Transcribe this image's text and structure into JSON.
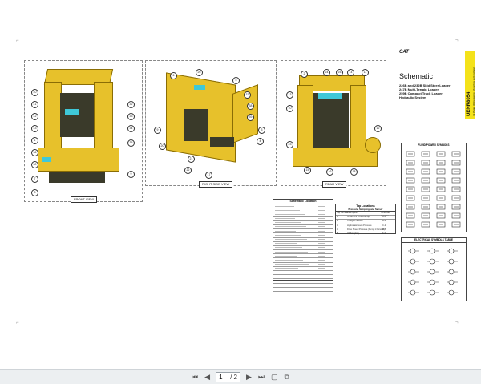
{
  "views": {
    "front_label": "FRONT VIEW",
    "right_side_label": "RIGHT SIDE VIEW",
    "rear_label": "REAR VIEW"
  },
  "title_block": {
    "brand": "CAT",
    "title": "Schematic",
    "subtitle_lines": [
      "226B and 232B Skid Steer Loader",
      "247B Multi-Terrain Loader",
      "259B Compact Track Loader",
      "Hydraulic System"
    ],
    "doc_code": "UENR8054",
    "doc_note": "42 Page, (Dimensions: 36 inches x 24 inches)"
  },
  "tables": {
    "harness_title": "Schematic Location",
    "tap_title": "Tap Locations",
    "tap_subtitle": "Pressure, Sampling, and Sensor",
    "tap_headers": [
      "Tap Number",
      "Description",
      "Schematic Location"
    ],
    "tap_rows": [
      [
        "1",
        "Implement Pressure Tap",
        "A-4"
      ],
      [
        "2",
        "Charge Pressure",
        "B-3"
      ],
      [
        "3",
        "Hydrostatic Loop Pressure",
        "C-2"
      ],
      [
        "4",
        "Drive Speed Pressure (Pump 1 Forward)",
        "D-5"
      ],
      [
        "5",
        "Oil Sampling",
        "E-6"
      ]
    ]
  },
  "symbols": {
    "fluid_title": "FLUID POWER SYMBOLS",
    "electrical_title": "ELECTRICAL SYMBOLS TABLE"
  },
  "toolbar": {
    "page_value": "1",
    "page_total": "/ 2"
  },
  "colors": {
    "machine_yellow": "#e7c12b",
    "title_stripe": "#f4e21a",
    "toolbar_bg": "#eceff1"
  }
}
